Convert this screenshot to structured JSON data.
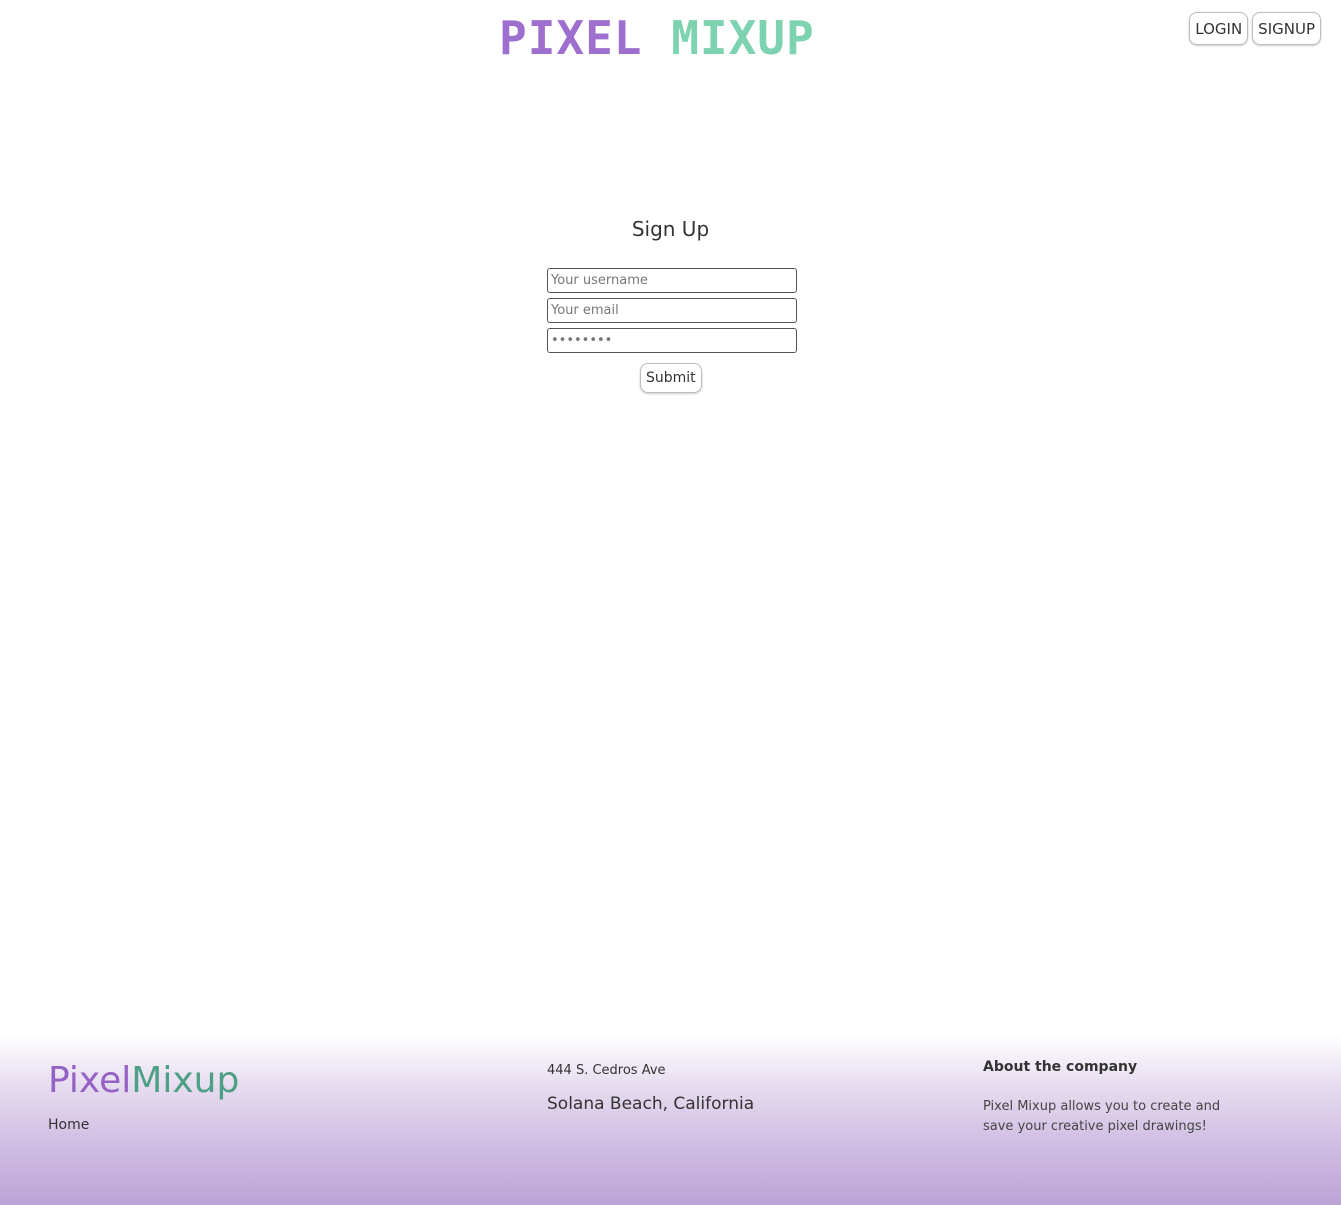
{
  "header": {
    "logo_part1": "PIXEL",
    "logo_part2": "MIXUP",
    "login_label": "LOGIN",
    "signup_label": "SIGNUP"
  },
  "signup_form": {
    "title": "Sign Up",
    "username_placeholder": "Your username",
    "email_placeholder": "Your email",
    "password_placeholder": "••••••••",
    "submit_label": "Submit"
  },
  "footer": {
    "brand_part1": "Pixel",
    "brand_part2": "Mixup",
    "home_link": "Home",
    "address_line1": "444 S. Cedros Ave",
    "address_line2": "Solana Beach, California",
    "about_title": "About the company",
    "about_text": "Pixel Mixup allows you to create and save your creative pixel drawings!"
  },
  "colors": {
    "logo_purple": "#9e6fcf",
    "logo_green": "#7dd3b0",
    "footer_gradient_end": "#bca4d6"
  }
}
